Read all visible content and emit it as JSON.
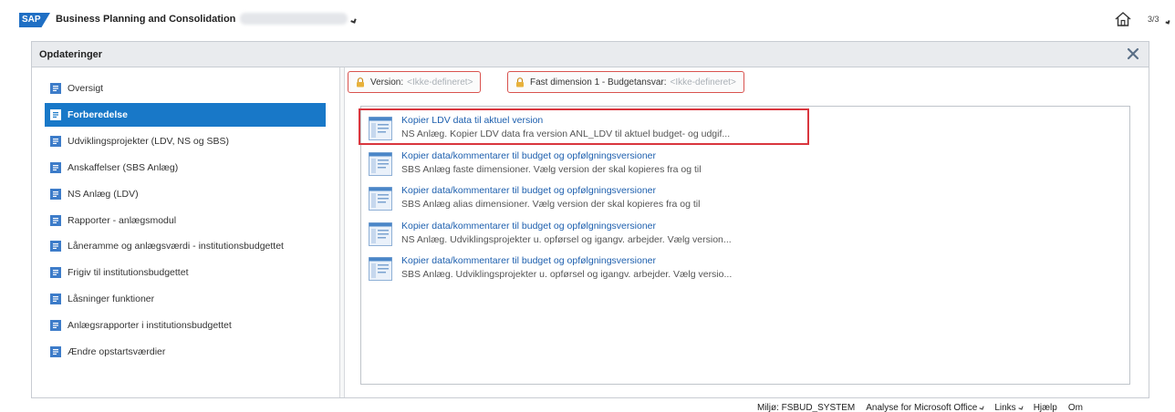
{
  "topbar": {
    "logo": "SAP",
    "app_title": "Business Planning and Consolidation",
    "page_count": "3/3"
  },
  "dialog": {
    "title": "Opdateringer",
    "close_icon": "close-icon"
  },
  "sidebar": {
    "items": [
      {
        "label": "Oversigt",
        "active": false
      },
      {
        "label": "Forberedelse",
        "active": true
      },
      {
        "label": "Udviklingsprojekter (LDV, NS og SBS)",
        "active": false
      },
      {
        "label": "Anskaffelser (SBS Anlæg)",
        "active": false
      },
      {
        "label": "NS Anlæg (LDV)",
        "active": false
      },
      {
        "label": "Rapporter - anlægsmodul",
        "active": false
      },
      {
        "label": "Låneramme og anlægsværdi - institutionsbudgettet",
        "active": false
      },
      {
        "label": "Frigiv til institutionsbudgettet",
        "active": false
      },
      {
        "label": "Låsninger funktioner",
        "active": false
      },
      {
        "label": "Anlægsrapporter i institutionsbudgettet",
        "active": false
      },
      {
        "label": "Ændre opstartsværdier",
        "active": false
      }
    ]
  },
  "filters": [
    {
      "label": "Version:",
      "value": "<Ikke-defineret>"
    },
    {
      "label": "Fast dimension 1 - Budgetansvar:",
      "value": "<Ikke-defineret>"
    }
  ],
  "tasks": [
    {
      "title": "Kopier LDV data til aktuel version",
      "desc": "NS Anlæg. Kopier LDV data fra version ANL_LDV til aktuel budget- og udgif..."
    },
    {
      "title": "Kopier data/kommentarer til budget og opfølgningsversioner",
      "desc": "SBS Anlæg faste dimensioner. Vælg version der skal kopieres fra og til"
    },
    {
      "title": "Kopier data/kommentarer til budget og opfølgningsversioner",
      "desc": "SBS Anlæg alias dimensioner. Vælg version der skal kopieres fra og til"
    },
    {
      "title": "Kopier data/kommentarer til budget og opfølgningsversioner",
      "desc": "NS Anlæg. Udviklingsprojekter u. opførsel og igangv. arbejder. Vælg version..."
    },
    {
      "title": "Kopier data/kommentarer til budget og opfølgningsversioner",
      "desc": "SBS Anlæg. Udviklingsprojekter u. opførsel og igangv. arbejder. Vælg versio..."
    }
  ],
  "footer": {
    "env": "Miljø: FSBUD_SYSTEM",
    "analysis": "Analyse for Microsoft Office",
    "links": "Links",
    "help": "Hjælp",
    "about": "Om"
  },
  "colors": {
    "accent": "#1878c8",
    "link": "#1d5fae",
    "highlight": "#d9363e"
  }
}
